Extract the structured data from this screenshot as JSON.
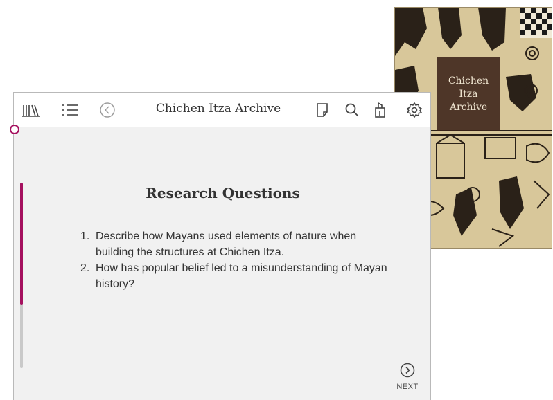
{
  "cover": {
    "title": "Chichen\nItza\nArchive",
    "accent_color": "#3a2218",
    "background_color": "#d8c79a"
  },
  "toolbar": {
    "title": "Chichen Itza Archive",
    "icons": [
      "library-icon",
      "list-icon",
      "back-icon",
      "bookmark-icon",
      "search-icon",
      "highlighter-icon",
      "settings-icon"
    ]
  },
  "content": {
    "heading": "Research Questions",
    "questions": [
      {
        "number": "1.",
        "text": "Describe how Mayans used elements of nature when building the structures at Chichen Itza."
      },
      {
        "number": "2.",
        "text": "How has popular belief led to a misunderstanding of Mayan history?"
      }
    ]
  },
  "navigation": {
    "next_label": "NEXT"
  },
  "progress": {
    "fraction_read": 0.66,
    "accent_color": "#a5115f"
  }
}
